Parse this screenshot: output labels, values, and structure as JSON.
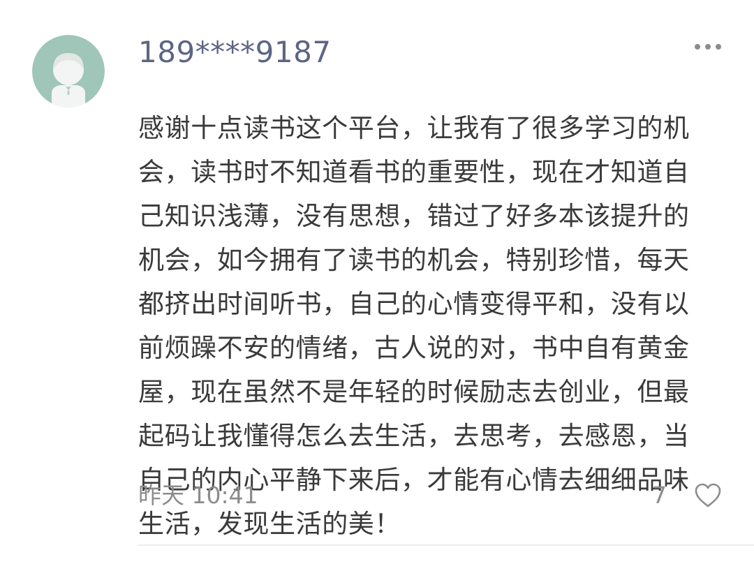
{
  "comment": {
    "username": "189****9187",
    "avatar_icon": "default-user-avatar-icon",
    "more_icon": "more-dots-icon",
    "text_lines": [
      "感谢十点读书这个平台，让我有了很多学习的机",
      "会，读书时不知道看书的重要性，现在才知道自",
      "己知识浅薄，没有思想，错过了好多本该提升的",
      "机会，如今拥有了读书的机会，特别珍惜，每天",
      "都挤出时间听书，自己的心情变得平和，没有以",
      "前烦躁不安的情绪，古人说的对，书中自有黄金",
      "屋，现在虽然不是年轻的时候励志去创业，但最",
      "起码让我懂得怎么去生活，去思考，去感恩，当",
      "自己的内心平静下来后，才能有心情去细细品味",
      "生活，发现生活的美！"
    ],
    "timestamp": "昨天 10:41",
    "like_count": "7",
    "like_icon": "heart-outline-icon"
  },
  "colors": {
    "avatar_bg": "#9fc6b8",
    "username": "#5c6585",
    "text": "#3a3a3a",
    "meta": "#8c8c8c"
  }
}
